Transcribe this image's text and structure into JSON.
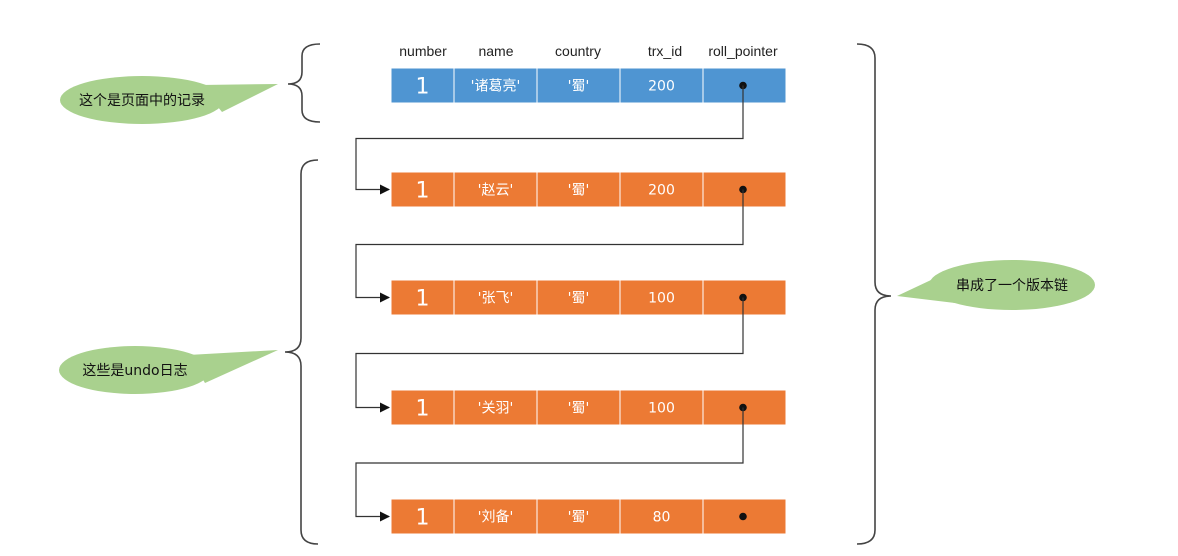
{
  "columns": [
    "number",
    "name",
    "country",
    "trx_id",
    "roll_pointer"
  ],
  "colors": {
    "current": "#4f95d2",
    "undo": "#ec7a34",
    "callout": "#a9d18e"
  },
  "rows": [
    {
      "kind": "current",
      "number": "1",
      "name": "'诸葛亮'",
      "country": "'蜀'",
      "trx_id": "200"
    },
    {
      "kind": "undo",
      "number": "1",
      "name": "'赵云'",
      "country": "'蜀'",
      "trx_id": "200"
    },
    {
      "kind": "undo",
      "number": "1",
      "name": "'张飞'",
      "country": "'蜀'",
      "trx_id": "100"
    },
    {
      "kind": "undo",
      "number": "1",
      "name": "'关羽'",
      "country": "'蜀'",
      "trx_id": "100"
    },
    {
      "kind": "undo",
      "number": "1",
      "name": "'刘备'",
      "country": "'蜀'",
      "trx_id": "80"
    }
  ],
  "callouts": {
    "page_record": "这个是页面中的记录",
    "undo_log": "这些是undo日志",
    "version_chain": "串成了一个版本链"
  }
}
